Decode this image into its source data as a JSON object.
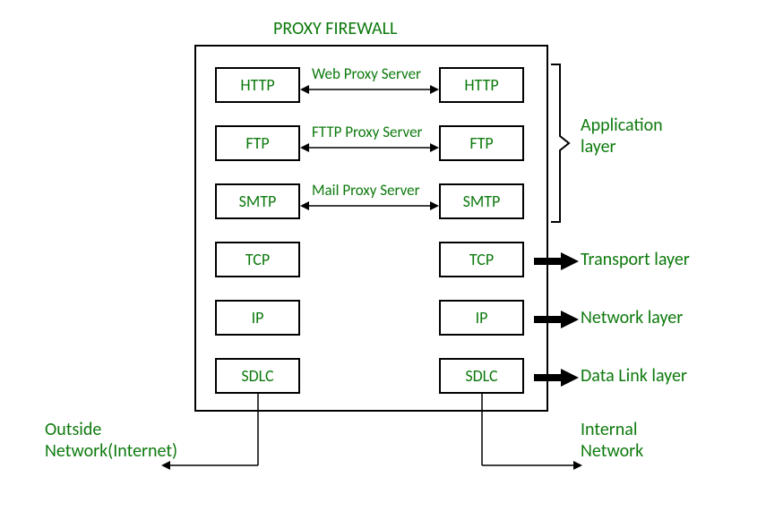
{
  "title": "PROXY FIREWALL",
  "left_col": {
    "http": "HTTP",
    "ftp": "FTP",
    "smtp": "SMTP",
    "tcp": "TCP",
    "ip": "IP",
    "sdlc": "SDLC"
  },
  "right_col": {
    "http": "HTTP",
    "ftp": "FTP",
    "smtp": "SMTP",
    "tcp": "TCP",
    "ip": "IP",
    "sdlc": "SDLC"
  },
  "proxies": {
    "web": "Web Proxy Server",
    "fttp": "FTTP Proxy Server",
    "mail": "Mail Proxy Server"
  },
  "layers": {
    "app1": "Application",
    "app2": "layer",
    "transport": "Transport layer",
    "network": "Network layer",
    "datalink": "Data Link layer"
  },
  "networks": {
    "outside1": "Outside",
    "outside2": "Network(Internet)",
    "internal1": "Internal",
    "internal2": "Network"
  }
}
